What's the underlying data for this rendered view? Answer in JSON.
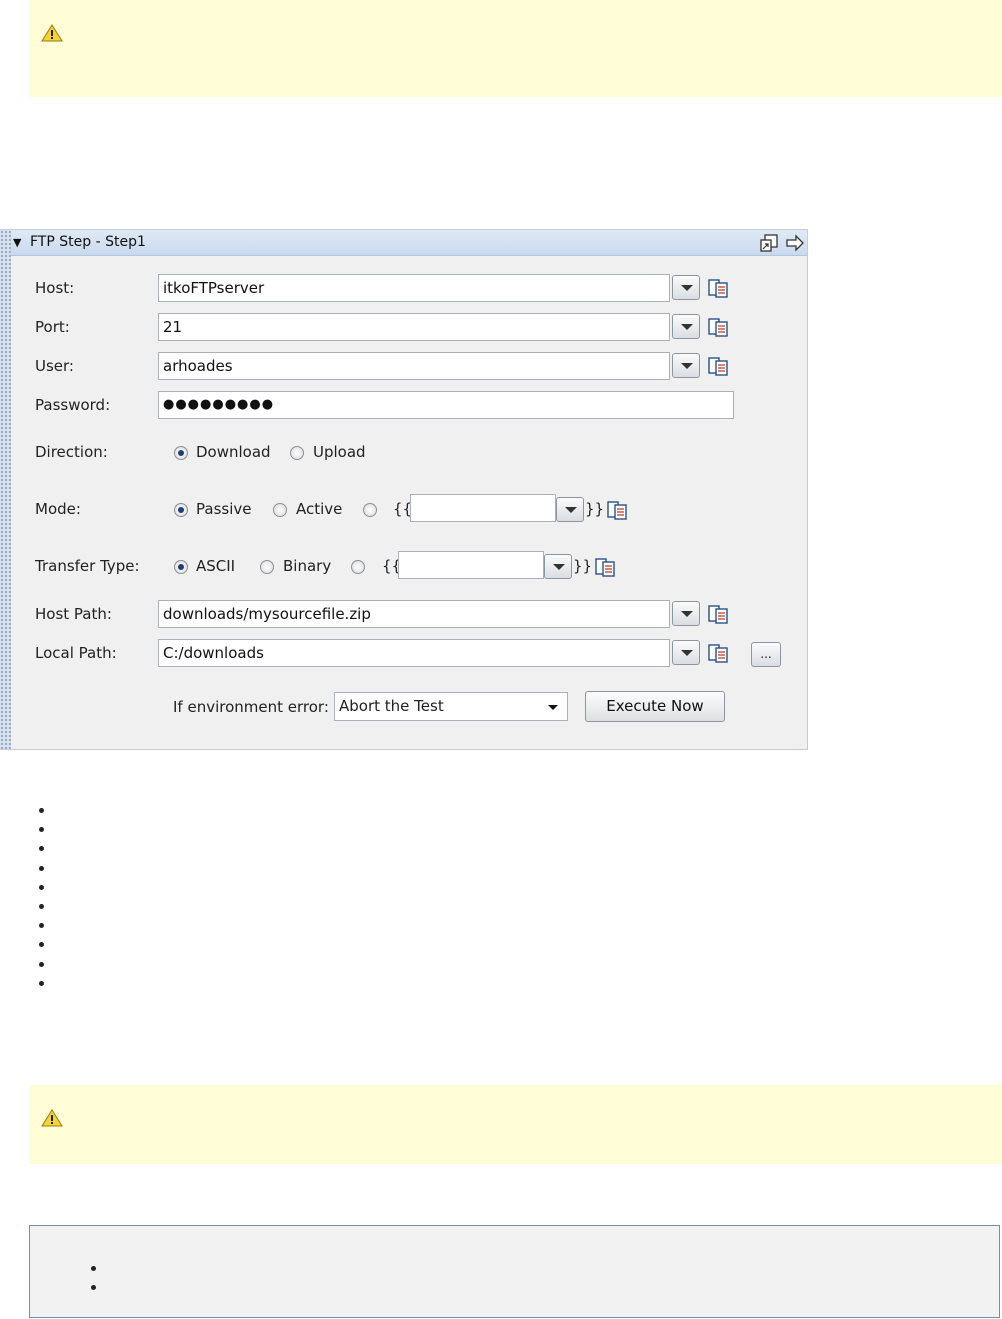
{
  "panel": {
    "title": "FTP Step - Step1",
    "fields": {
      "host": {
        "label": "Host:",
        "value": "itkoFTPserver"
      },
      "port": {
        "label": "Port:",
        "value": "21"
      },
      "user": {
        "label": "User:",
        "value": "arhoades"
      },
      "password": {
        "label": "Password:",
        "value": "●●●●●●●●●"
      },
      "host_path": {
        "label": "Host Path:",
        "value": "downloads/mysourcefile.zip"
      },
      "local_path": {
        "label": "Local Path:",
        "value": "C:/downloads"
      }
    },
    "direction": {
      "label": "Direction:",
      "options": [
        "Download",
        "Upload"
      ],
      "selected": "Download"
    },
    "mode": {
      "label": "Mode:",
      "options": [
        "Passive",
        "Active"
      ],
      "selected": "Passive",
      "open": "{{",
      "close": "}}"
    },
    "transfer_type": {
      "label": "Transfer Type:",
      "options": [
        "ASCII",
        "Binary"
      ],
      "selected": "ASCII",
      "open": "{{",
      "close": "}}"
    },
    "browse_label": "...",
    "env_error": {
      "label": "If environment error:",
      "value": "Abort the Test"
    },
    "execute_label": "Execute Now"
  },
  "icons": {
    "warning": "warning-triangle-icon",
    "clipboard": "property-sheet-icon",
    "popout": "pop-out-icon",
    "arrow": "right-arrow-icon"
  },
  "colors": {
    "warning_bg": "#fffdd5",
    "header_bg": "#c9d9ee",
    "info_border": "#6f8fb8"
  }
}
